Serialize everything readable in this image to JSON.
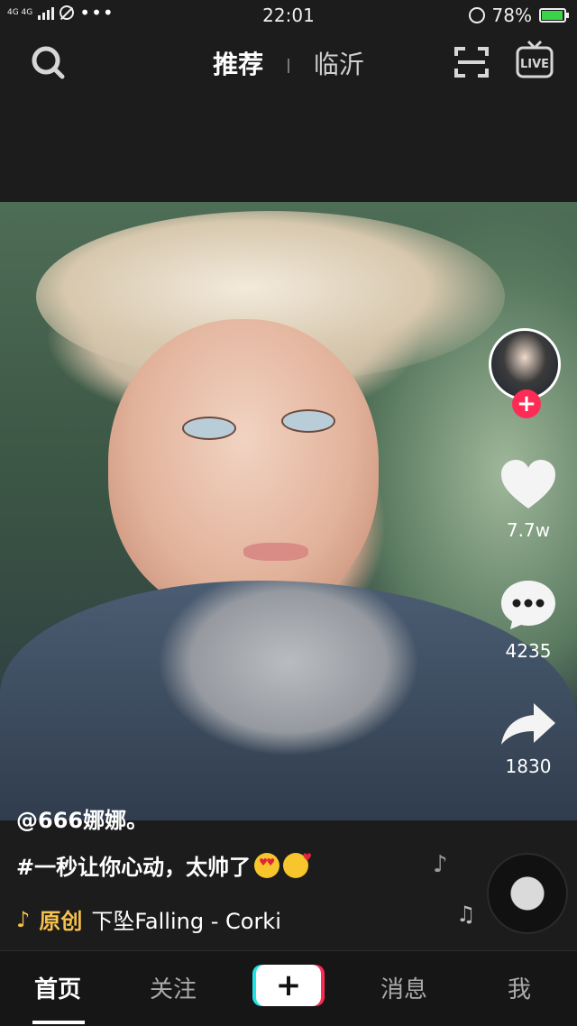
{
  "status_bar": {
    "network_label": "4G 4G",
    "time": "22:01",
    "battery_percent": "78%",
    "battery_level": 0.78,
    "icons": [
      "signal-icon",
      "no-disturb-icon",
      "more-dots-icon",
      "alarm-icon",
      "battery-icon"
    ]
  },
  "top_nav": {
    "tab_recommend": "推荐",
    "tab_local": "临沂",
    "icons": [
      "search-icon",
      "scan-icon",
      "live-icon"
    ],
    "live_label": "LIVE"
  },
  "side_actions": {
    "like_count": "7.7w",
    "comment_count": "4235",
    "share_count": "1830",
    "follow_plus": "+"
  },
  "post": {
    "author": "@666娜娜。",
    "caption": "#一秒让你心动，太帅了",
    "caption_emojis": [
      "heart-eyes-emoji",
      "kiss-emoji"
    ]
  },
  "music": {
    "original_label": "原创",
    "song": "下坠Falling - Corki"
  },
  "bottom_nav": {
    "home": "首页",
    "following": "关注",
    "create": "+",
    "messages": "消息",
    "me": "我"
  },
  "colors": {
    "accent_red": "#fe2c55",
    "accent_cyan": "#22e3e4",
    "music_gold": "#f6c04c",
    "background": "#1c1c1c"
  }
}
